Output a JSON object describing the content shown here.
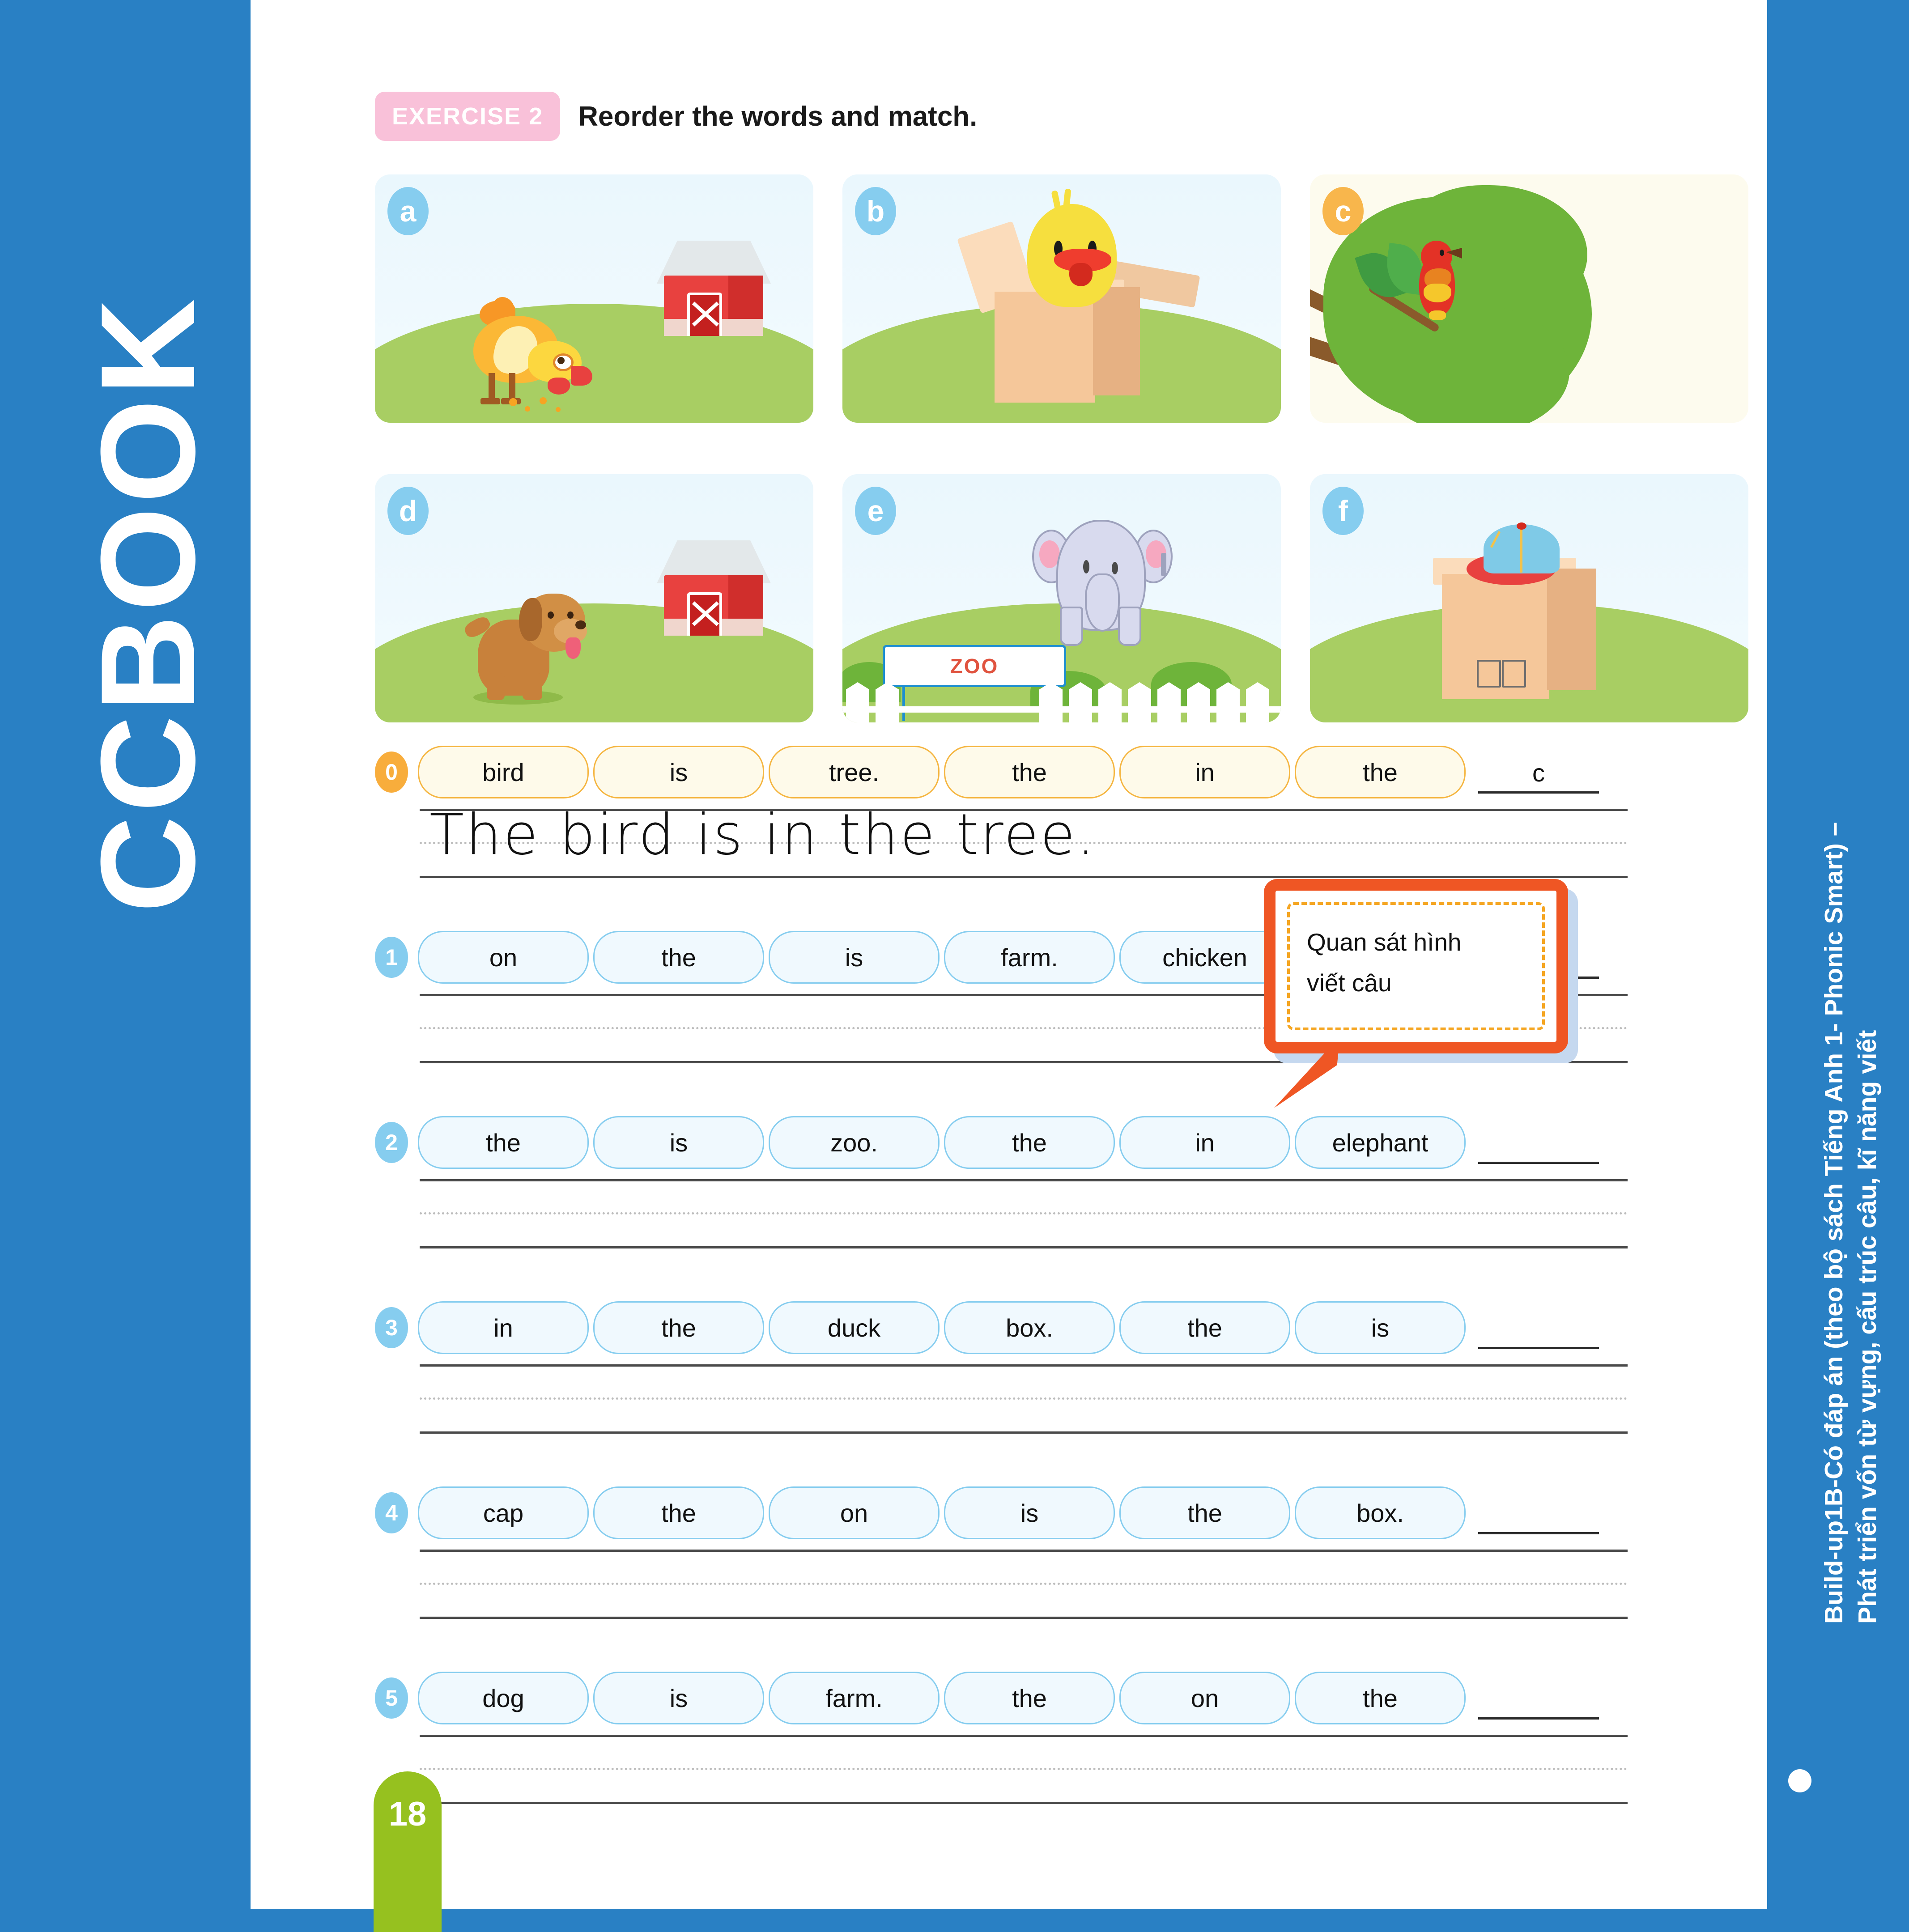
{
  "brand": {
    "logo": "CCBOOK"
  },
  "footer": {
    "note": "Build-up1B-Có đáp án (theo bộ sách Tiếng Anh 1- Phonic Smart) –\nPhát triển vốn từ vựng, cấu trúc câu, kĩ năng viết"
  },
  "header": {
    "badge": "EXERCISE 2",
    "instruction": "Reorder the words and match."
  },
  "pictures": [
    {
      "label": "a",
      "alt": "chicken on the farm with red barn"
    },
    {
      "label": "b",
      "alt": "duck in the box"
    },
    {
      "label": "c",
      "alt": "bird in the tree"
    },
    {
      "label": "d",
      "alt": "dog on the farm with red barn"
    },
    {
      "label": "e",
      "alt": "elephant in the zoo"
    },
    {
      "label": "f",
      "alt": "cap on the box"
    }
  ],
  "zoo_sign": "ZOO",
  "example": {
    "number": "0",
    "words": [
      "bird",
      "is",
      "tree.",
      "the",
      "in",
      "the"
    ],
    "answer": "c",
    "written_sentence": "The bird is in the tree."
  },
  "questions": [
    {
      "number": "1",
      "words": [
        "on",
        "the",
        "is",
        "farm.",
        "chicken"
      ],
      "answer": ""
    },
    {
      "number": "2",
      "words": [
        "the",
        "is",
        "zoo.",
        "the",
        "in",
        "elephant"
      ],
      "answer": ""
    },
    {
      "number": "3",
      "words": [
        "in",
        "the",
        "duck",
        "box.",
        "the",
        "is"
      ],
      "answer": ""
    },
    {
      "number": "4",
      "words": [
        "cap",
        "the",
        "on",
        "is",
        "the",
        "box."
      ],
      "answer": ""
    },
    {
      "number": "5",
      "words": [
        "dog",
        "is",
        "farm.",
        "the",
        "on",
        "the"
      ],
      "answer": ""
    }
  ],
  "tip_bubble": {
    "text": "Quan sát hình\nviết câu"
  },
  "page_number": "18",
  "colors": {
    "spine_blue": "#2980c4",
    "badge_pink": "#f9c1d9",
    "pill_blue_border": "#86cdef",
    "pill_orange_border": "#f5b642",
    "bubble_orange": "#ef5624",
    "page_tab_green": "#96c11f"
  }
}
